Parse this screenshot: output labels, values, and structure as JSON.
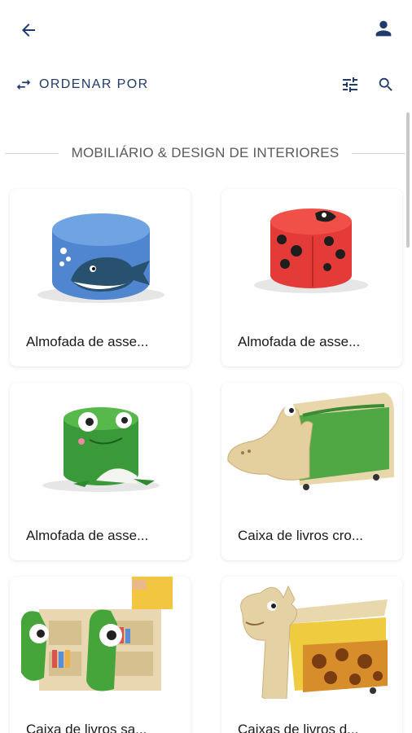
{
  "header": {
    "back_icon": "arrow-left-icon",
    "user_icon": "person-icon",
    "icon_color": "#1f3a6b"
  },
  "toolbar": {
    "sort_label": "ORDENAR POR",
    "sort_icon": "swap-horizontal-icon",
    "filter_icon": "sliders-icon",
    "search_icon": "search-icon"
  },
  "section": {
    "title": "MOBILIÁRIO & DESIGN DE INTERIORES"
  },
  "products": [
    {
      "name": "Almofada de asse...",
      "image": "blue-whale-seat"
    },
    {
      "name": "Almofada de asse...",
      "image": "red-ladybug-seat"
    },
    {
      "name": "Almofada de asse...",
      "image": "green-frog-seat"
    },
    {
      "name": "Caixa de livros cro...",
      "image": "crocodile-book-box"
    },
    {
      "name": "Caixa de livros sa...",
      "image": "frog-bookcase"
    },
    {
      "name": "Caixas de livros d...",
      "image": "giraffe-book-box"
    }
  ]
}
